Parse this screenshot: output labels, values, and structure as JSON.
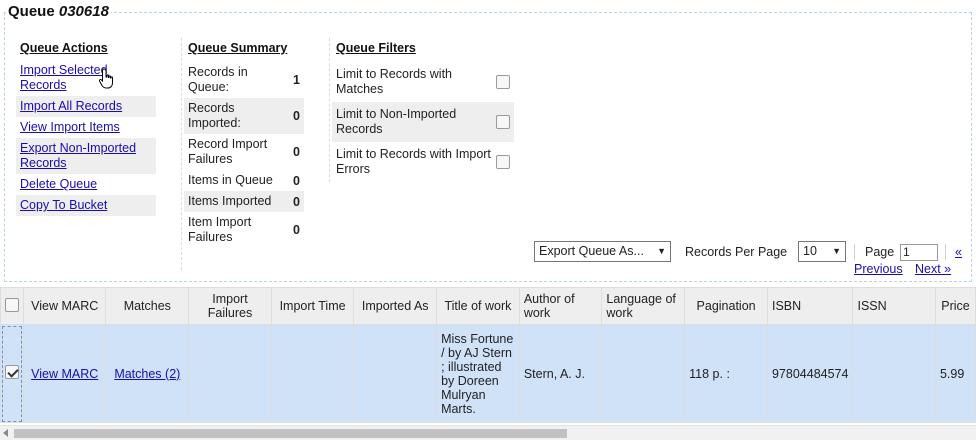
{
  "queue": {
    "title_prefix": "Queue",
    "title_id": "030618"
  },
  "actions": {
    "heading": "Queue Actions",
    "items": [
      {
        "label": "Import Selected Records"
      },
      {
        "label": "Import All Records"
      },
      {
        "label": "View Import Items"
      },
      {
        "label": "Export Non-Imported Records"
      },
      {
        "label": "Delete Queue"
      },
      {
        "label": "Copy To Bucket"
      }
    ]
  },
  "summary": {
    "heading": "Queue Summary",
    "rows": [
      {
        "label": "Records in Queue:",
        "value": "1"
      },
      {
        "label": "Records Imported:",
        "value": "0"
      },
      {
        "label": "Record Import Failures",
        "value": "0"
      },
      {
        "label": "Items in Queue",
        "value": "0"
      },
      {
        "label": "Items Imported",
        "value": "0"
      },
      {
        "label": "Item Import Failures",
        "value": "0"
      }
    ]
  },
  "filters": {
    "heading": "Queue Filters",
    "rows": [
      {
        "label": "Limit to Records with Matches",
        "checked": false
      },
      {
        "label": "Limit to Non-Imported Records",
        "checked": false
      },
      {
        "label": "Limit to Records with Import Errors",
        "checked": false
      }
    ]
  },
  "pager": {
    "export_label": "Export Queue As...",
    "records_per_page_label": "Records Per Page",
    "records_per_page_value": "10",
    "page_label": "Page",
    "page_value": "1",
    "first_label": "«",
    "previous_label": "Previous",
    "next_label": "Next »"
  },
  "grid": {
    "columns": [
      "",
      "View MARC",
      "Matches",
      "Import Failures",
      "Import Time",
      "Imported As",
      "Title of work",
      "Author of work",
      "Language of work",
      "Pagination",
      "ISBN",
      "ISSN",
      "Price"
    ],
    "rows": [
      {
        "selected": true,
        "view_marc": "View MARC",
        "matches": "Matches (2)",
        "import_failures": "",
        "import_time": "",
        "imported_as": "",
        "title": "Miss Fortune / by AJ Stern ; illustrated by Doreen Mulryan Marts.",
        "author": "Stern, A. J.",
        "language": "",
        "pagination": "118 p. :",
        "isbn": "97804484574",
        "issn": "",
        "price": "5.99"
      }
    ]
  }
}
